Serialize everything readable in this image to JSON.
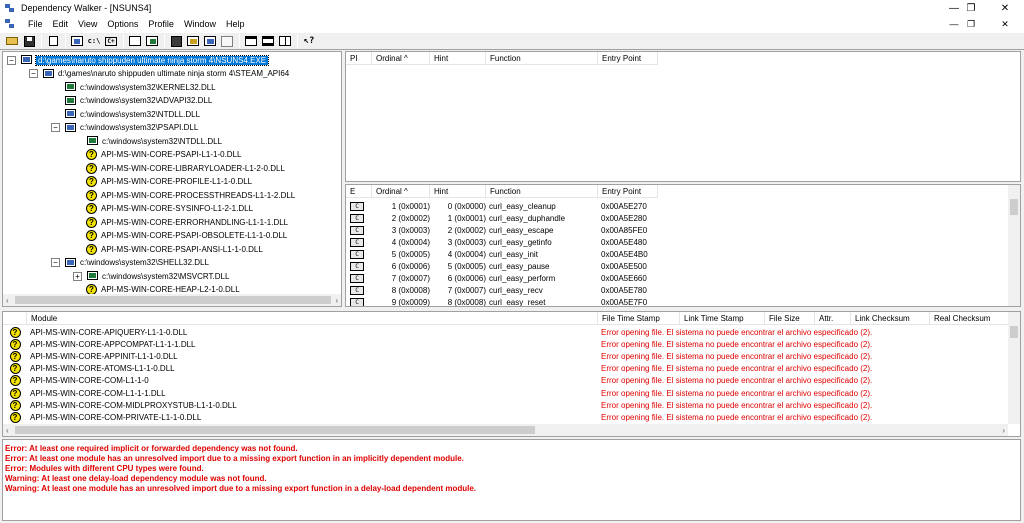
{
  "window": {
    "title": "Dependency Walker - [NSUNS4]",
    "minimize_glyph": "—",
    "restore_glyph": "❐",
    "close_glyph": "✕"
  },
  "menu": [
    "File",
    "Edit",
    "View",
    "Options",
    "Profile",
    "Window",
    "Help"
  ],
  "toolbar": {
    "buttons": [
      "open",
      "save",
      "copy",
      "find",
      "c:\\",
      "C+",
      "view-full-paths",
      "undecorate",
      "properties",
      "profile",
      "stop",
      "auto-expand",
      "collapse",
      "expand-all",
      "highlight",
      "split",
      "help"
    ],
    "c_label": "c:\\",
    "cpp_label": "C+"
  },
  "tree": {
    "nodes": [
      {
        "level": 0,
        "text": "d:\\games\\naruto shippuden ultimate ninja storm 4\\NSUNS4.EXE",
        "icon": "app",
        "expand": "−",
        "selected": true
      },
      {
        "level": 1,
        "text": "d:\\games\\naruto shippuden ultimate ninja storm 4\\STEAM_API64",
        "icon": "app",
        "expand": "−"
      },
      {
        "level": 2,
        "text": "c:\\windows\\system32\\KERNEL32.DLL",
        "icon": "sys"
      },
      {
        "level": 2,
        "text": "c:\\windows\\system32\\ADVAPI32.DLL",
        "icon": "sys"
      },
      {
        "level": 2,
        "text": "c:\\windows\\system32\\NTDLL.DLL",
        "icon": "app"
      },
      {
        "level": 2,
        "text": "c:\\windows\\system32\\PSAPI.DLL",
        "icon": "app",
        "expand": "−"
      },
      {
        "level": 3,
        "text": "c:\\windows\\system32\\NTDLL.DLL",
        "icon": "sys"
      },
      {
        "level": 3,
        "text": "API-MS-WIN-CORE-PSAPI-L1-1-0.DLL",
        "icon": "q"
      },
      {
        "level": 3,
        "text": "API-MS-WIN-CORE-LIBRARYLOADER-L1-2-0.DLL",
        "icon": "q"
      },
      {
        "level": 3,
        "text": "API-MS-WIN-CORE-PROFILE-L1-1-0.DLL",
        "icon": "q"
      },
      {
        "level": 3,
        "text": "API-MS-WIN-CORE-PROCESSTHREADS-L1-1-2.DLL",
        "icon": "q"
      },
      {
        "level": 3,
        "text": "API-MS-WIN-CORE-SYSINFO-L1-2-1.DLL",
        "icon": "q"
      },
      {
        "level": 3,
        "text": "API-MS-WIN-CORE-ERRORHANDLING-L1-1-1.DLL",
        "icon": "q"
      },
      {
        "level": 3,
        "text": "API-MS-WIN-CORE-PSAPI-OBSOLETE-L1-1-0.DLL",
        "icon": "q"
      },
      {
        "level": 3,
        "text": "API-MS-WIN-CORE-PSAPI-ANSI-L1-1-0.DLL",
        "icon": "q"
      },
      {
        "level": 2,
        "text": "c:\\windows\\system32\\SHELL32.DLL",
        "icon": "app",
        "expand": "−"
      },
      {
        "level": 3,
        "text": "c:\\windows\\system32\\MSVCRT.DLL",
        "icon": "sys",
        "expand": "+"
      },
      {
        "level": 3,
        "text": "API-MS-WIN-CORE-HEAP-L2-1-0.DLL",
        "icon": "q"
      }
    ],
    "scroll_left": "‹",
    "scroll_right": "›"
  },
  "imports": {
    "headers": [
      "PI",
      "Ordinal ^",
      "Hint",
      "Function",
      "Entry Point"
    ]
  },
  "exports": {
    "headers": [
      "E",
      "Ordinal ^",
      "Hint",
      "Function",
      "Entry Point"
    ],
    "icon_label": "C",
    "rows": [
      {
        "ordinal": "1 (0x0001)",
        "hint": "0 (0x0000)",
        "function": "curl_easy_cleanup",
        "entry": "0x00A5E270"
      },
      {
        "ordinal": "2 (0x0002)",
        "hint": "1 (0x0001)",
        "function": "curl_easy_duphandle",
        "entry": "0x00A5E280"
      },
      {
        "ordinal": "3 (0x0003)",
        "hint": "2 (0x0002)",
        "function": "curl_easy_escape",
        "entry": "0x00A85FE0"
      },
      {
        "ordinal": "4 (0x0004)",
        "hint": "3 (0x0003)",
        "function": "curl_easy_getinfo",
        "entry": "0x00A5E480"
      },
      {
        "ordinal": "5 (0x0005)",
        "hint": "4 (0x0004)",
        "function": "curl_easy_init",
        "entry": "0x00A5E4B0"
      },
      {
        "ordinal": "6 (0x0006)",
        "hint": "5 (0x0005)",
        "function": "curl_easy_pause",
        "entry": "0x00A5E500"
      },
      {
        "ordinal": "7 (0x0007)",
        "hint": "6 (0x0006)",
        "function": "curl_easy_perform",
        "entry": "0x00A5E660"
      },
      {
        "ordinal": "8 (0x0008)",
        "hint": "7 (0x0007)",
        "function": "curl_easy_recv",
        "entry": "0x00A5E780"
      },
      {
        "ordinal": "9 (0x0009)",
        "hint": "8 (0x0008)",
        "function": "curl_easy_reset",
        "entry": "0x00A5E7F0"
      }
    ]
  },
  "modules": {
    "headers": [
      "",
      "Module",
      "File Time Stamp",
      "Link Time Stamp",
      "File Size",
      "Attr.",
      "Link Checksum",
      "Real Checksum"
    ],
    "error_text": "Error opening file. El sistema no puede encontrar el archivo especificado (2).",
    "rows": [
      "API-MS-WIN-CORE-APIQUERY-L1-1-0.DLL",
      "API-MS-WIN-CORE-APPCOMPAT-L1-1-1.DLL",
      "API-MS-WIN-CORE-APPINIT-L1-1-0.DLL",
      "API-MS-WIN-CORE-ATOMS-L1-1-0.DLL",
      "API-MS-WIN-CORE-COM-L1-1-0",
      "API-MS-WIN-CORE-COM-L1-1-1.DLL",
      "API-MS-WIN-CORE-COM-MIDLPROXYSTUB-L1-1-0.DLL",
      "API-MS-WIN-CORE-COM-PRIVATE-L1-1-0.DLL"
    ]
  },
  "log": [
    "Error: At least one required implicit or forwarded dependency was not found.",
    "Error: At least one module has an unresolved import due to a missing export function in an implicitly dependent module.",
    "Error: Modules with different CPU types were found.",
    "Warning: At least one delay-load dependency module was not found.",
    "Warning: At least one module has an unresolved import due to a missing export function in a delay-load dependent module."
  ],
  "colors": {
    "error": "#e00000",
    "selection": "#0078d7",
    "question_icon": "#f3e300"
  }
}
